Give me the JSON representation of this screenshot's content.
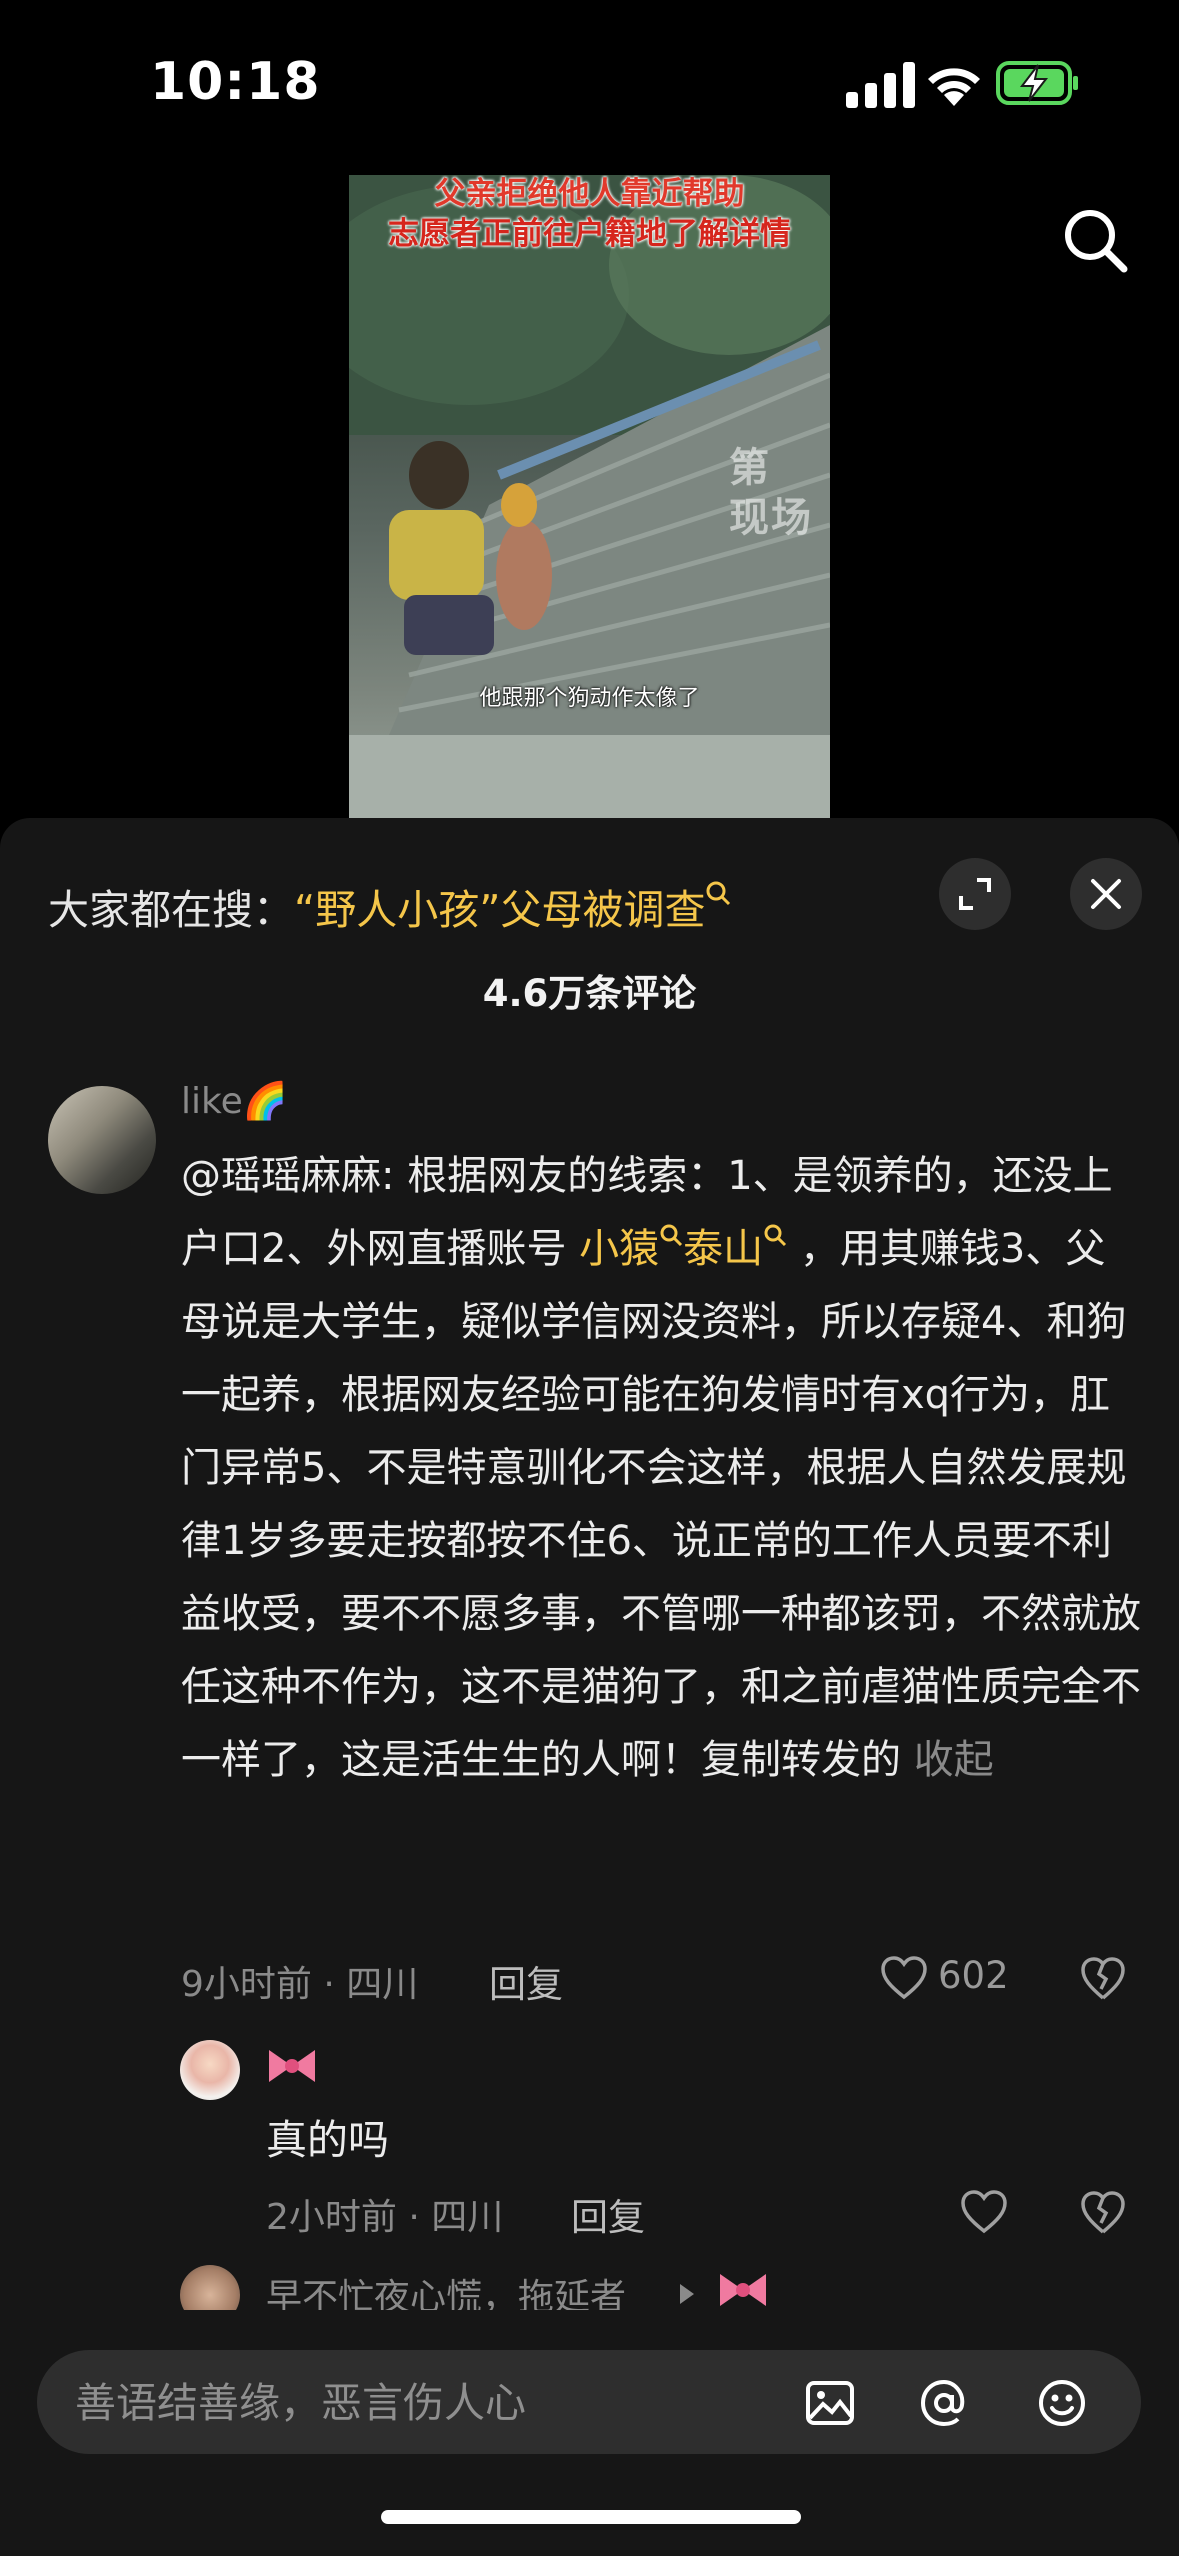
{
  "status_bar": {
    "time": "10:18"
  },
  "video": {
    "caption_line1": "父亲拒绝他人靠近帮助",
    "caption_line2": "志愿者正前往户籍地了解详情",
    "subtitle": "他跟那个狗动作太像了",
    "watermark_line1": "第",
    "watermark_line2": "现场"
  },
  "comments_panel": {
    "hot_search_prefix": "大家都在搜：",
    "hot_search_keyword": "“野人小孩”父母被调查",
    "comment_count": "4.6万条评论",
    "comments": [
      {
        "username": "like🌈",
        "text_part1": "@瑶瑶麻麻: 根据网友的线索：1、是领养的，还没上户口2、外网直播账号 ",
        "link1": "小猿",
        "link2": "泰山",
        "text_part2": "  ，用其赚钱3、父母说是大学生，疑似学信网没资料，所以存疑4、和狗一起养，根据网友经验可能在狗发情时有xq行为，肛门异常5、不是特意驯化不会这样，根据人自然发展规律1岁多要走按都按不住6、说正常的工作人员要不利益收受，要不不愿多事，不管哪一种都该罚，不然就放任这种不作为，这不是猫狗了，和之前虐猫性质完全不一样了，这是活生生的人啊！复制转发的",
        "collapse_label": " 收起",
        "meta": "9小时前 · 四川",
        "reply_label": "回复",
        "likes": "602"
      }
    ],
    "replies": [
      {
        "username": "🎀",
        "text": "真的吗",
        "meta": "2小时前 · 四川",
        "reply_label": "回复"
      },
      {
        "username": "早不忙夜心慌，拖延者"
      }
    ],
    "input_placeholder": "善语结善缘，恶言伤人心"
  },
  "colors": {
    "accent": "#f5c64a",
    "sheet_bg": "#161616",
    "battery": "#5ad75e"
  }
}
